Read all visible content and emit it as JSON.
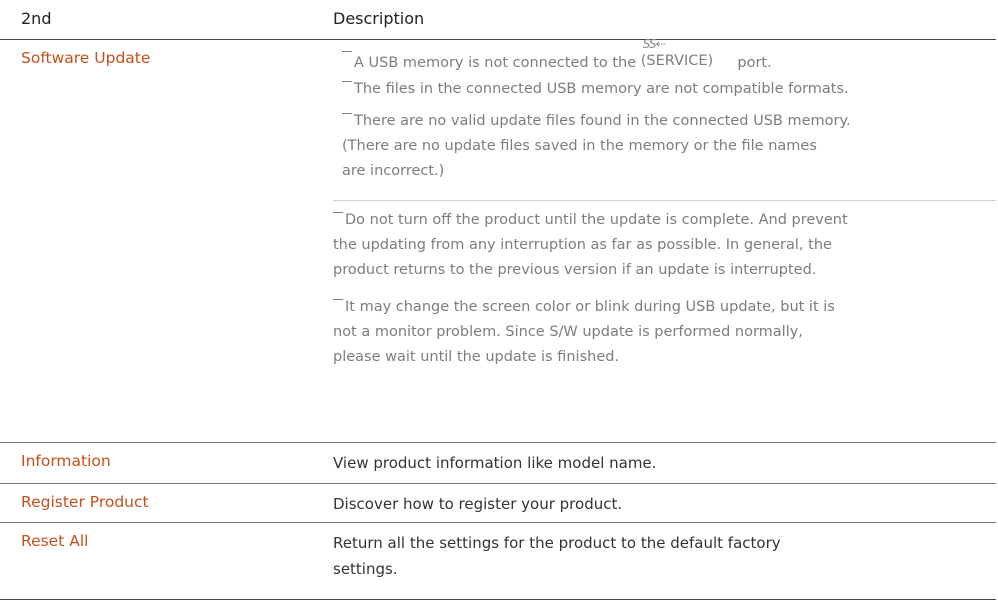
{
  "header": {
    "col1": "2nd",
    "col2": "Description"
  },
  "rows": [
    {
      "name": "Software Update",
      "notes_nested": [
        {
          "before": "A USB memory is not connected to the ",
          "port_label": "(SERVICE)",
          "after": " port.",
          "icon": "ss-usb-icon",
          "icon_text": "SS⇠"
        },
        {
          "text": "The files in the connected USB memory are not compatible formats."
        },
        {
          "text": "There are no valid update files found in the connected USB memory.",
          "line2": "(There are no update files saved in the memory or the file names",
          "line3": "are incorrect.)"
        }
      ],
      "notes": [
        {
          "line1": "Do not turn off the product until the update is complete. And prevent",
          "line2": "the updating from any interruption as far as possible. In general, the",
          "line3": "product returns to the previous version if an update is interrupted."
        },
        {
          "line1": "It may change the screen color or blink during USB update, but it is",
          "line2": "not a monitor problem. Since S/W update is performed normally,",
          "line3": "please wait until the update is finished."
        }
      ]
    },
    {
      "name": "Information",
      "description": "View product information like model name."
    },
    {
      "name": "Register Product",
      "description": "Discover how to register your product."
    },
    {
      "name": "Reset All",
      "description": "Return all the settings for the product to the default factory",
      "description2": "settings."
    }
  ]
}
